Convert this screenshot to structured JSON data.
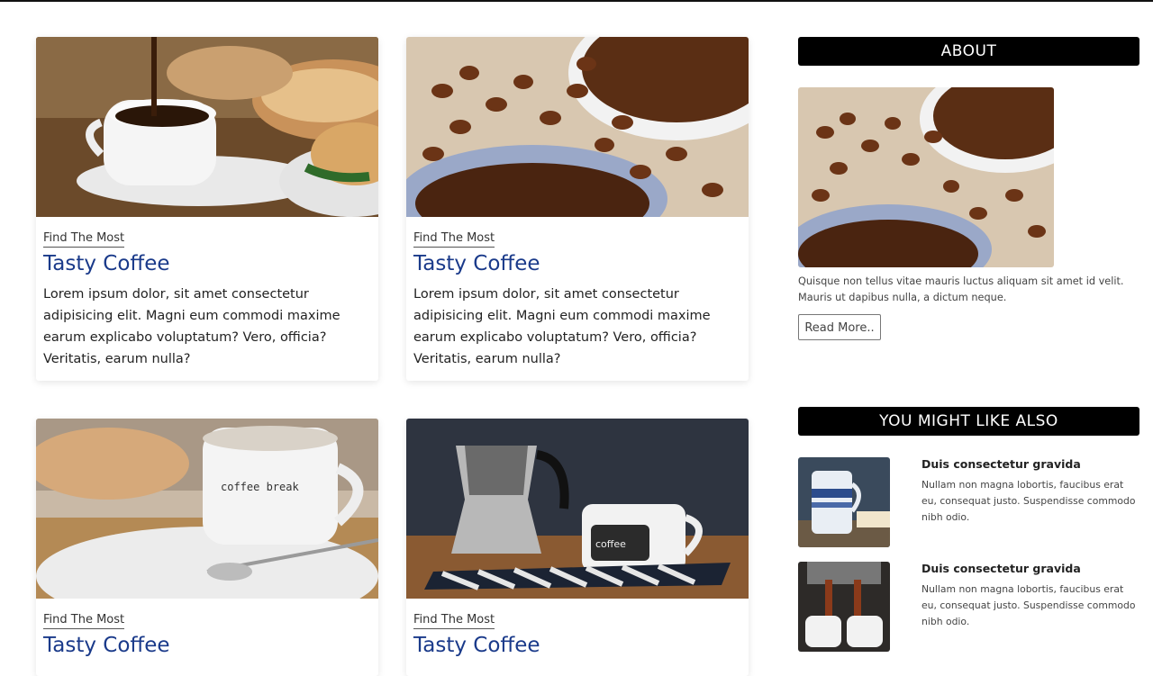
{
  "posts": [
    {
      "kicker": "Find The Most",
      "title": "Tasty Coffee",
      "text": "Lorem ipsum dolor, sit amet consectetur adipisicing elit. Magni eum commodi maxime earum explicabo voluptatum? Vero, officia? Veritatis, earum nulla?"
    },
    {
      "kicker": "Find The Most",
      "title": "Tasty Coffee",
      "text": "Lorem ipsum dolor, sit amet consectetur adipisicing elit. Magni eum commodi maxime earum explicabo voluptatum? Vero, officia? Veritatis, earum nulla?"
    },
    {
      "kicker": "Find The Most",
      "title": "Tasty Coffee"
    },
    {
      "kicker": "Find The Most",
      "title": "Tasty Coffee"
    }
  ],
  "sidebar": {
    "about": {
      "heading": "ABOUT",
      "text": "Quisque non tellus vitae mauris luctus aliquam sit amet id velit. Mauris ut dapibus nulla, a dictum neque.",
      "button": "Read More.."
    },
    "related": {
      "heading": "YOU MIGHT LIKE ALSO",
      "items": [
        {
          "title": "Duis consectetur gravida",
          "text": "Nullam non magna lobortis, faucibus erat eu, consequat justo. Suspendisse commodo nibh odio."
        },
        {
          "title": "Duis consectetur gravida",
          "text": "Nullam non magna lobortis, faucibus erat eu, consequat justo. Suspendisse commodo nibh odio."
        }
      ]
    }
  },
  "mug_text": {
    "cup1": "coffee break",
    "cup2": "coffee"
  },
  "colors": {
    "title_blue": "#1a3a8a",
    "header_black": "#000000"
  }
}
